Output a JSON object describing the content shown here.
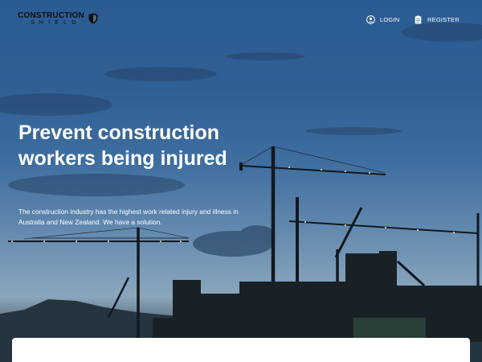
{
  "brand": {
    "name": "CONSTRUCTION",
    "subtitle": "SHIELD",
    "shield_icon": "shield-icon"
  },
  "nav": {
    "login": {
      "label": "LOGIN",
      "icon": "user-icon"
    },
    "register": {
      "label": "REGISTER",
      "icon": "clipboard-icon"
    }
  },
  "hero": {
    "title": "Prevent construction workers being injured",
    "description": "The construction industry has the highest work related injury and illness in Australia and New Zealand. We have a solution."
  },
  "colors": {
    "sky_top": "#2b5b93",
    "sky_horizon": "#8aa6bc",
    "ground": "#1e262b",
    "card": "#ffffff"
  }
}
